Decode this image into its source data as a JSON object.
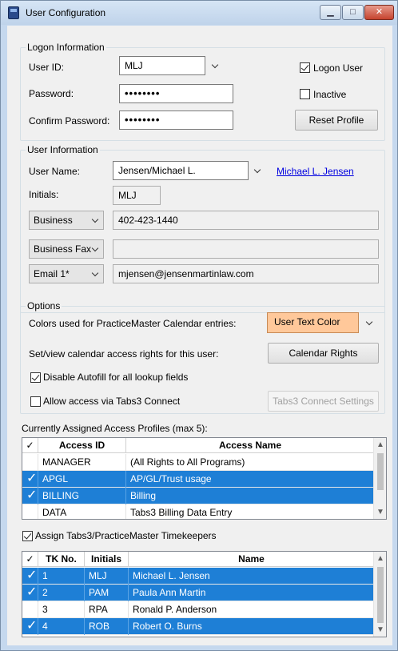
{
  "window": {
    "title": "User Configuration",
    "min_glyph": "▁",
    "max_glyph": "□",
    "close_glyph": "✕"
  },
  "logon": {
    "group_title": "Logon Information",
    "user_id_label": "User ID:",
    "user_id_value": "MLJ",
    "password_label": "Password:",
    "password_value": "••••••••",
    "confirm_label": "Confirm Password:",
    "confirm_value": "••••••••",
    "logon_user_label": "Logon User",
    "logon_user_checked": true,
    "inactive_label": "Inactive",
    "inactive_checked": false,
    "reset_label": "Reset Profile"
  },
  "user_info": {
    "group_title": "User Information",
    "user_name_label": "User Name:",
    "user_name_value": "Jensen/Michael L.",
    "user_link": "Michael L. Jensen",
    "initials_label": "Initials:",
    "initials_value": "MLJ",
    "phones": [
      {
        "type": "Business",
        "value": "402-423-1440"
      },
      {
        "type": "Business Fax",
        "value": ""
      },
      {
        "type": "Email 1*",
        "value": "mjensen@jensenmartinlaw.com"
      }
    ]
  },
  "options": {
    "group_title": "Options",
    "colors_label": "Colors used for PracticeMaster Calendar entries:",
    "color_button": "User Text Color",
    "color_value": "#ffc89a",
    "rights_label": "Set/view calendar access rights for this user:",
    "rights_button": "Calendar Rights",
    "autofill_label": "Disable Autofill for all lookup fields",
    "autofill_checked": true,
    "tabs3_label": "Allow access via Tabs3 Connect",
    "tabs3_checked": false,
    "tabs3_button": "Tabs3 Connect Settings"
  },
  "profiles": {
    "caption": "Currently Assigned Access Profiles (max 5):",
    "headers": {
      "check": "✓",
      "id": "Access ID",
      "name": "Access Name"
    },
    "rows": [
      {
        "checked": false,
        "id": "MANAGER",
        "name": "(All Rights to All Programs)"
      },
      {
        "checked": true,
        "id": "APGL",
        "name": "AP/GL/Trust usage"
      },
      {
        "checked": true,
        "id": "BILLING",
        "name": "Billing"
      },
      {
        "checked": false,
        "id": "DATA",
        "name": "Tabs3 Billing Data Entry"
      }
    ]
  },
  "timekeepers": {
    "assign_label": "Assign Tabs3/PracticeMaster Timekeepers",
    "assign_checked": true,
    "headers": {
      "check": "✓",
      "tk": "TK No.",
      "initials": "Initials",
      "name": "Name"
    },
    "rows": [
      {
        "checked": true,
        "tk": "1",
        "initials": "MLJ",
        "name": "Michael L. Jensen"
      },
      {
        "checked": true,
        "tk": "2",
        "initials": "PAM",
        "name": "Paula Ann Martin"
      },
      {
        "checked": false,
        "tk": "3",
        "initials": "RPA",
        "name": "Ronald P. Anderson"
      },
      {
        "checked": true,
        "tk": "4",
        "initials": "ROB",
        "name": "Robert O. Burns"
      }
    ]
  },
  "colors": {
    "selection": "#1e7fd6",
    "link": "#0000e0"
  },
  "tick_glyph": "✓",
  "scroll_up": "▲",
  "scroll_down": "▼"
}
